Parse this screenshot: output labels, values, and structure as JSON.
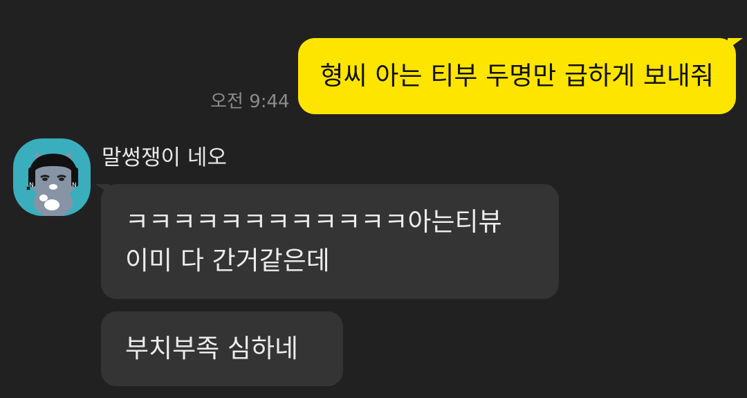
{
  "outgoing": {
    "time": "오전 9:44",
    "text": "형씨 아는 티부 두명만 급하게 보내줘"
  },
  "incoming": {
    "sender_name": "말썽쟁이 네오",
    "avatar_icon": "neo-character-avatar",
    "messages": [
      {
        "lines": [
          "ㅋㅋㅋㅋㅋㅋㅋㅋㅋㅋㅋㅋ아는티뷰",
          "이미 다 간거같은데"
        ]
      },
      {
        "lines": [
          "부치부족 심하네"
        ]
      }
    ]
  },
  "colors": {
    "background": "#212121",
    "outgoing_bubble": "#fee500",
    "incoming_bubble": "#343434",
    "avatar_bg": "#3aaebd"
  }
}
